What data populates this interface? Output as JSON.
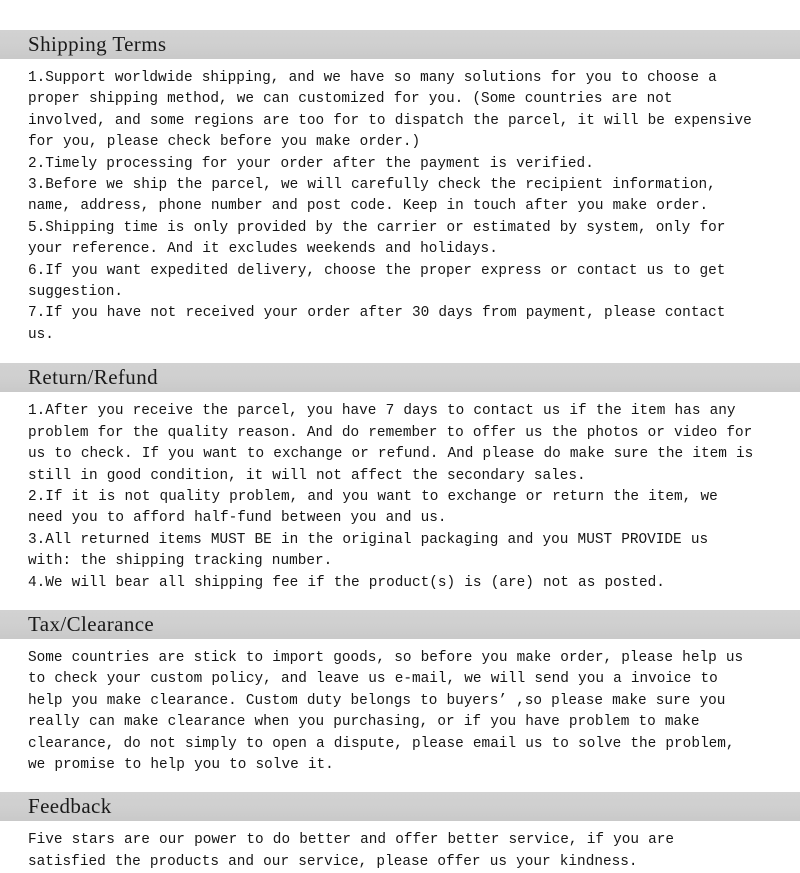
{
  "document": {
    "type": "shipping-policy-document",
    "background_color": "#ffffff",
    "heading_band_color": "#cfcfcf",
    "text_color": "#151515"
  },
  "sections": [
    {
      "id": "shipping-terms",
      "heading": "Shipping Terms",
      "body": "1.Support worldwide shipping, and we have so many solutions for you to choose a\nproper shipping method, we can customized for you. (Some countries are not\ninvolved, and some regions are too for to dispatch the parcel, it will be expensive\nfor you, please check before you make order.)\n2.Timely processing for your order after the payment is verified.\n3.Before we ship the parcel, we will carefully check the recipient information,\nname, address, phone number and post code. Keep in touch after you make order.\n5.Shipping time is only provided by the carrier or estimated by system, only for\nyour reference. And it excludes weekends and holidays.\n6.If you want expedited delivery, choose the proper express or contact us to get\nsuggestion.\n7.If you have not received your order after 30 days from payment, please contact\nus."
    },
    {
      "id": "return-refund",
      "heading": "Return/Refund",
      "body": "1.After you receive the parcel, you have 7 days to contact us if the item has any\nproblem for the quality reason. And do remember to offer us the photos or video for\nus to check. If you want to exchange or refund. And please do make sure the item is\nstill in good condition, it will not affect the secondary sales.\n2.If it is not quality problem, and you want to exchange or return the item, we\nneed you to afford half-fund between you and us.\n3.All returned items MUST BE in the original packaging and you MUST PROVIDE us\nwith: the shipping tracking number.\n4.We will bear all shipping fee if the product(s) is (are) not as posted."
    },
    {
      "id": "tax-clearance",
      "heading": "Tax/Clearance",
      "body": "Some countries are stick to import goods, so before you make order, please help us\nto check your custom policy, and leave us e-mail, we will send you a invoice to\nhelp you make clearance. Custom duty belongs to buyers’ ,so please make sure you\nreally can make clearance when you purchasing, or if you have problem to make\nclearance, do not simply to open a dispute, please email us to solve the problem,\nwe promise to help you to solve it."
    },
    {
      "id": "feedback",
      "heading": "Feedback",
      "body": "Five stars are our power to do better and offer better service, if you are\nsatisfied the products and our service, please offer us your kindness."
    }
  ]
}
